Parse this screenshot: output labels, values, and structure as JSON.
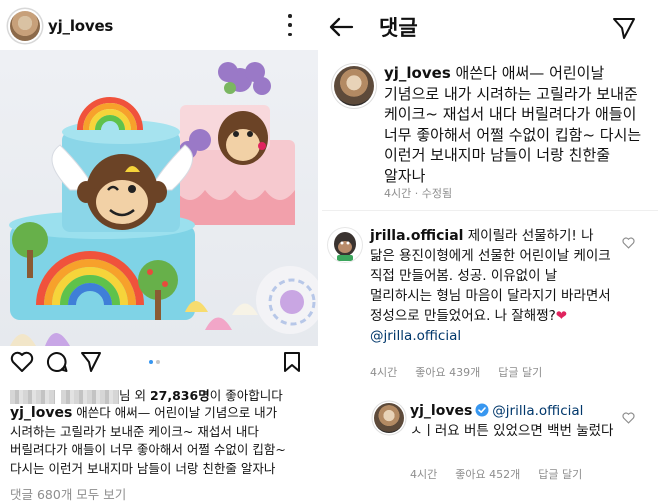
{
  "post": {
    "username": "yj_loves",
    "likes_suffix": "님 외",
    "likes_count": "27,836명",
    "likes_text": "이 좋아합니다",
    "caption_user": "yj_loves",
    "caption_text": "애쓴다 애써— 어린이날 기념으로 내가 시려하는 고릴라가 보내준 케이크~ 재섭서 내다 버릴려다가 애들이 너무 좋아해서 어쩔 수없이 킵함~ 다시는 이런거 보내지마 남들이 너랑 친한줄 알자나",
    "view_comments": "댓글 680개 모두 보기"
  },
  "comments_screen": {
    "title": "댓글",
    "caption_comment": {
      "username": "yj_loves",
      "text": "애쓴다 애써— 어린이날 기념으로 내가 시려하는 고릴라가 보내준 케이크~ 재섭서 내다 버릴려다가 애들이 너무 좋아해서 어쩔 수없이 킵함~ 다시는 이런거 보내지마 남들이 너랑 친한줄 알자나",
      "time": "4시간 · 수정됨"
    },
    "comment1": {
      "username": "jrilla.official",
      "text": "제이릴라 선물하기! 나 닮은 용진이형에게 선물한 어린이날 케이크 직접 만들어봄. 성공. 이유없이 날 멀리하시는 형님 마음이 달라지기 바라면서 정성으로 만들었어요. 나 잘해쩡?",
      "heart_emoji": "❤",
      "mention": "@jrilla.official",
      "time": "4시간",
      "likes": "좋아요 439개",
      "reply": "답글 달기"
    },
    "reply1": {
      "username": "yj_loves",
      "mention": "@jrilla.official",
      "text": "ㅅㅣ러요 버튼 있었으면 백번 눌렀다",
      "time": "4시간",
      "likes": "좋아요 452개",
      "reply": "답글 달기"
    }
  },
  "icons": {
    "heart": "heart-icon",
    "comment": "comment-icon",
    "share": "send-icon",
    "bookmark": "bookmark-icon",
    "back": "back-arrow-icon",
    "more": "more-icon"
  },
  "colors": {
    "link": "#00376b",
    "muted": "#8e8e8e",
    "carousel_active": "#3897f0",
    "verified": "#3897f0",
    "heart_red": "#e0245e"
  }
}
